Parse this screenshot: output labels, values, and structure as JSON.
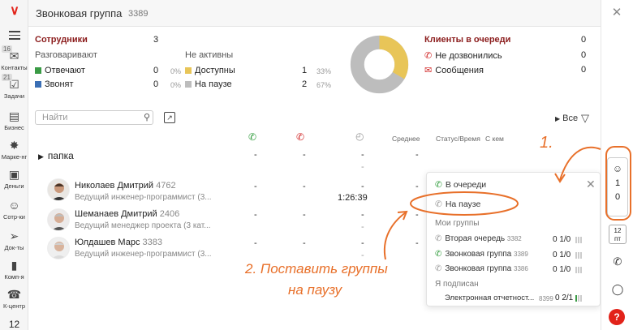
{
  "header": {
    "title": "Звонковая группа",
    "number": "3389"
  },
  "nav": [
    {
      "label": "Контакты",
      "badge": "16",
      "icon": "chat-icon"
    },
    {
      "label": "Задачи",
      "badge": "21",
      "icon": "tasks-icon"
    },
    {
      "label": "Бизнес",
      "icon": "briefcase-icon"
    },
    {
      "label": "Марке-нг",
      "icon": "marketing-icon"
    },
    {
      "label": "Деньги",
      "icon": "wallet-icon"
    },
    {
      "label": "Сотр-ки",
      "icon": "staff-icon"
    },
    {
      "label": "Док-ты",
      "icon": "send-icon"
    },
    {
      "label": "Комп-я",
      "icon": "company-icon"
    },
    {
      "label": "К-центр",
      "icon": "headset-icon"
    },
    {
      "label": "12",
      "icon": "calendar-icon"
    }
  ],
  "stats": {
    "employees_label": "Сотрудники",
    "employees_value": "3",
    "talking_label": "Разговаривают",
    "answering_label": "Отвечают",
    "answering_value": "0",
    "answering_pct": "0%",
    "calling_label": "Звонят",
    "calling_value": "0",
    "calling_pct": "0%",
    "inactive_label": "Не активны",
    "available_label": "Доступны",
    "available_value": "1",
    "available_pct": "33%",
    "paused_label": "На паузе",
    "paused_value": "2",
    "paused_pct": "67%",
    "queue_label": "Клиенты в очереди",
    "queue_value": "0",
    "missed_label": "Не дозвонились",
    "missed_value": "0",
    "messages_label": "Сообщения",
    "messages_value": "0"
  },
  "donut": {
    "available": 1,
    "paused": 2,
    "colors": {
      "available": "#e8c558",
      "paused": "#bdbdbd"
    }
  },
  "toolbar": {
    "search_placeholder": "Найти",
    "filter_label": "Все"
  },
  "table": {
    "col_avg": "Среднее",
    "col_status": "Статус/Время",
    "col_with": "С кем",
    "folder": "папка",
    "dash": "-",
    "rows": [
      {
        "name": "Николаев Дмитрий",
        "id": "4762",
        "role": "Ведущий инженер-программист (3...",
        "time": "1:26:39"
      },
      {
        "name": "Шеманаев Дмитрий",
        "id": "2406",
        "role": "Ведущий менеджер проекта (3 кат..."
      },
      {
        "name": "Юлдашев Марс",
        "id": "3383",
        "role": "Ведущий инженер-программист (3..."
      }
    ]
  },
  "popup": {
    "in_queue": "В очереди",
    "on_pause": "На паузе",
    "my_groups": "Мои группы",
    "groups": [
      {
        "name": "Вторая очередь",
        "id": "3382",
        "count": "0 1/0",
        "phone": "grey"
      },
      {
        "name": "Звонковая группа",
        "id": "3389",
        "count": "0 1/0",
        "phone": "green"
      },
      {
        "name": "Звонковая группа",
        "id": "3386",
        "count": "0 1/0",
        "phone": "grey"
      }
    ],
    "subscribed": "Я подписан",
    "sub_group": {
      "name": "Электронная отчетност...",
      "id": "8399",
      "count": "0 2/1"
    }
  },
  "rightrail": {
    "count_top": "1",
    "count_bottom": "0",
    "cal_top": "12",
    "cal_bottom": "пт",
    "help": "?"
  },
  "annotations": {
    "step1": "1.",
    "step2_line1": "2. Поставить группы",
    "step2_line2": "на паузу"
  },
  "accent": "#e8702a"
}
